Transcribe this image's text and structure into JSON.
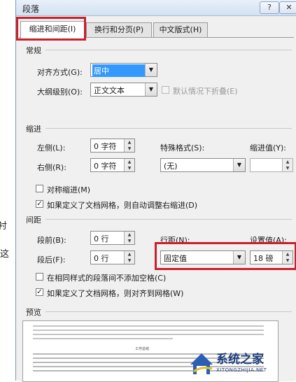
{
  "window": {
    "title": "段落",
    "help_label": "?",
    "close_label": "✕"
  },
  "tabs": [
    {
      "label": "缩进和间距(I)",
      "active": true
    },
    {
      "label": "换行和分页(P)",
      "active": false
    },
    {
      "label": "中文版式(H)",
      "active": false
    }
  ],
  "general": {
    "heading": "常规",
    "alignment_label": "对齐方式(G):",
    "alignment_value": "居中",
    "outline_label": "大纲级别(O):",
    "outline_value": "正文文本",
    "collapse_label": "默认情况下折叠(E)"
  },
  "indent": {
    "heading": "缩进",
    "left_label": "左侧(L):",
    "left_value": "0 字符",
    "right_label": "右侧(R):",
    "right_value": "0 字符",
    "special_label": "特殊格式(S):",
    "special_value": "(无)",
    "by_label": "缩进值(Y):",
    "by_value": "",
    "mirror_label": "对称缩进(M)",
    "auto_adjust_label": "如果定义了文档网格，则自动调整右缩进(D)"
  },
  "spacing": {
    "heading": "间距",
    "before_label": "段前(B):",
    "before_value": "0 行",
    "after_label": "段后(F):",
    "after_value": "0 行",
    "line_label": "行距(N):",
    "line_value": "固定值",
    "at_label": "设置值(A):",
    "at_value": "18 磅",
    "no_space_label": "在相同样式的段落间不添加空格(C)",
    "snap_grid_label": "如果定义了文档网格，则对齐到网格(W)"
  },
  "preview": {
    "heading": "预览",
    "sample_title": "工作总结"
  },
  "background_doc": {
    "glyphs": [
      "衬",
      "这"
    ]
  },
  "watermark": {
    "name": "系统之家",
    "url": "XITONGZHIJIA.NET"
  },
  "colors": {
    "highlight": "#c8202d",
    "selection": "#3399ff"
  }
}
